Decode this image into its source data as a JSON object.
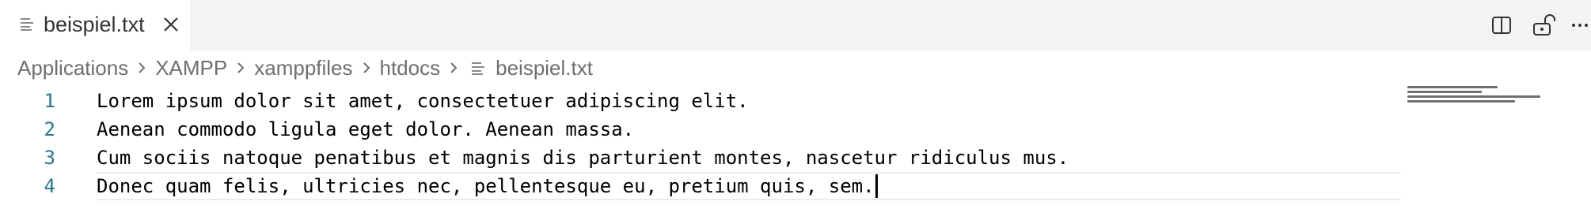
{
  "tab": {
    "label": "beispiel.txt",
    "icon": "text-file-icon",
    "close_icon": "close-icon"
  },
  "actions": [
    {
      "name": "split-editor",
      "icon": "split-editor-icon"
    },
    {
      "name": "toggle-readonly",
      "icon": "unlock-icon"
    },
    {
      "name": "more-actions",
      "icon": "ellipsis-icon"
    }
  ],
  "breadcrumb": {
    "items": [
      "Applications",
      "XAMPP",
      "xamppfiles",
      "htdocs",
      "beispiel.txt"
    ]
  },
  "editor": {
    "lines": [
      {
        "number": "1",
        "text": "Lorem ipsum dolor sit amet, consectetuer adipiscing elit."
      },
      {
        "number": "2",
        "text": "Aenean commodo ligula eget dolor. Aenean massa."
      },
      {
        "number": "3",
        "text": "Cum sociis natoque penatibus et magnis dis parturient montes, nascetur ridiculus mus."
      },
      {
        "number": "4",
        "text": "Donec quam felis, ultricies nec, pellentesque eu, pretium quis, sem."
      }
    ],
    "current_line": 4
  },
  "colors": {
    "tabbar_bg": "#f3f3f3",
    "line_number": "#237893",
    "breadcrumb_text": "#6f6f6f",
    "text": "#000000"
  }
}
